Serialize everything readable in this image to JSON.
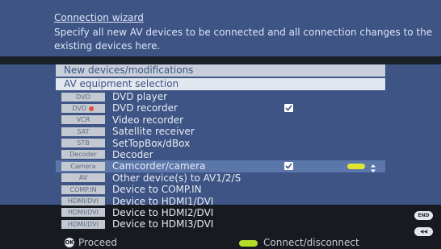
{
  "wizard": {
    "title": "Connection wizard",
    "description": "Specify all new AV devices to be connected and all connection changes to the existing devices here."
  },
  "sections": {
    "new_devices": "New devices/modifications",
    "av_selection": "AV equipment selection"
  },
  "devices": [
    {
      "tag": "DVD",
      "label": "DVD player",
      "checked": false,
      "recording": false
    },
    {
      "tag": "DVD",
      "label": "DVD recorder",
      "checked": true,
      "recording": true
    },
    {
      "tag": "VCR",
      "label": "Video recorder",
      "checked": false,
      "recording": false
    },
    {
      "tag": "SAT",
      "label": "Satellite receiver",
      "checked": false,
      "recording": false
    },
    {
      "tag": "STB",
      "label": "SetTopBox/dBox",
      "checked": false,
      "recording": false
    },
    {
      "tag": "Decoder",
      "label": "Decoder",
      "checked": false,
      "recording": false
    },
    {
      "tag": "Camera",
      "label": "Camcorder/camera",
      "checked": true,
      "recording": false,
      "focused": true
    },
    {
      "tag": "AV",
      "label": "Other device(s) to AV1/2/S",
      "checked": false,
      "recording": false
    },
    {
      "tag": "COMP.IN",
      "label": "Device to COMP.IN",
      "checked": false,
      "recording": false
    },
    {
      "tag": "HDMI/DVI",
      "label": "Device to HDMI1/DVI",
      "checked": false,
      "recording": false
    },
    {
      "tag": "HDMI/DVI",
      "label": "Device to HDMI2/DVI",
      "checked": false,
      "recording": false
    },
    {
      "tag": "HDMI/DVI",
      "label": "Device to HDMI3/DVI",
      "checked": false,
      "recording": false
    }
  ],
  "footer": {
    "ok_icon": "OK",
    "proceed_label": "Proceed",
    "connect_label": "Connect/disconnect"
  },
  "side_buttons": {
    "end_label": "END",
    "back_label": "◀◀"
  },
  "colors": {
    "panel_blue": "#3d5484",
    "focus_row": "#5b77aa",
    "yellow_key": "#e0e431",
    "green_key": "#b4dc2b",
    "record_dot": "#e0553a"
  }
}
